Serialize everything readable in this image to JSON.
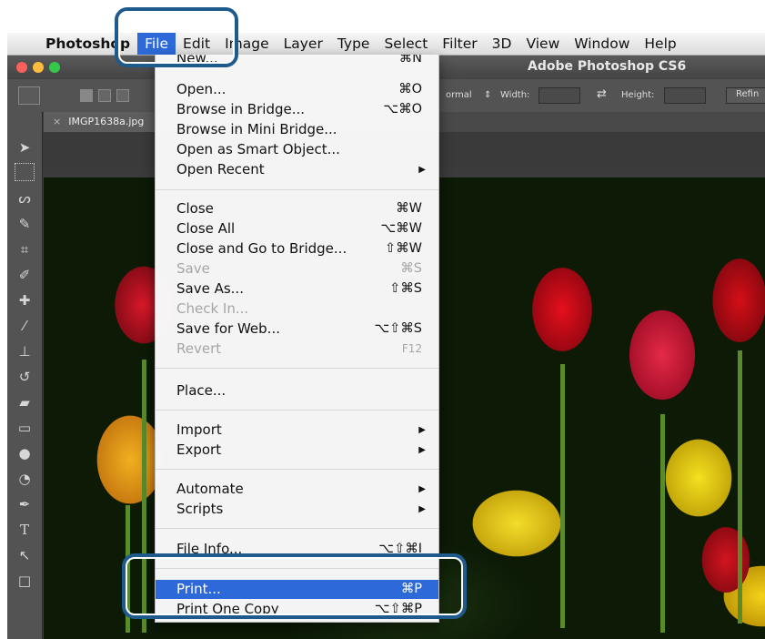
{
  "menubar": {
    "app_name": "Photoshop",
    "items": [
      "File",
      "Edit",
      "Image",
      "Layer",
      "Type",
      "Select",
      "Filter",
      "3D",
      "View",
      "Window",
      "Help"
    ]
  },
  "window": {
    "title": "Adobe Photoshop CS6"
  },
  "options_bar": {
    "style_value": "ormal",
    "width_label": "Width:",
    "height_label": "Height:",
    "refine_label": "Refin"
  },
  "document_tab": {
    "close_glyph": "×",
    "name": "IMGP1638a.jpg"
  },
  "file_menu": {
    "groups": [
      [
        {
          "label": "New...",
          "shortcut": "⌘N"
        },
        {
          "label": "Open...",
          "shortcut": "⌘O"
        },
        {
          "label": "Browse in Bridge...",
          "shortcut": "⌥⌘O"
        },
        {
          "label": "Browse in Mini Bridge...",
          "shortcut": ""
        },
        {
          "label": "Open as Smart Object...",
          "shortcut": ""
        },
        {
          "label": "Open Recent",
          "shortcut": "",
          "submenu": true
        }
      ],
      [
        {
          "label": "Close",
          "shortcut": "⌘W"
        },
        {
          "label": "Close All",
          "shortcut": "⌥⌘W"
        },
        {
          "label": "Close and Go to Bridge...",
          "shortcut": "⇧⌘W"
        },
        {
          "label": "Save",
          "shortcut": "⌘S",
          "disabled": true
        },
        {
          "label": "Save As...",
          "shortcut": "⇧⌘S"
        },
        {
          "label": "Check In...",
          "shortcut": "",
          "disabled": true
        },
        {
          "label": "Save for Web...",
          "shortcut": "⌥⇧⌘S"
        },
        {
          "label": "Revert",
          "shortcut": "F12",
          "disabled": true
        }
      ],
      [
        {
          "label": "Place...",
          "shortcut": ""
        }
      ],
      [
        {
          "label": "Import",
          "shortcut": "",
          "submenu": true
        },
        {
          "label": "Export",
          "shortcut": "",
          "submenu": true
        }
      ],
      [
        {
          "label": "Automate",
          "shortcut": "",
          "submenu": true
        },
        {
          "label": "Scripts",
          "shortcut": "",
          "submenu": true
        }
      ],
      [
        {
          "label": "File Info...",
          "shortcut": "⌥⇧⌘I"
        }
      ],
      [
        {
          "label": "Print...",
          "shortcut": "⌘P",
          "highlighted": true
        },
        {
          "label": "Print One Copy",
          "shortcut": "⌥⇧⌘P"
        }
      ]
    ]
  },
  "colors": {
    "menu_highlight": "#2d69d8",
    "callout_border": "#1e5a8c"
  }
}
